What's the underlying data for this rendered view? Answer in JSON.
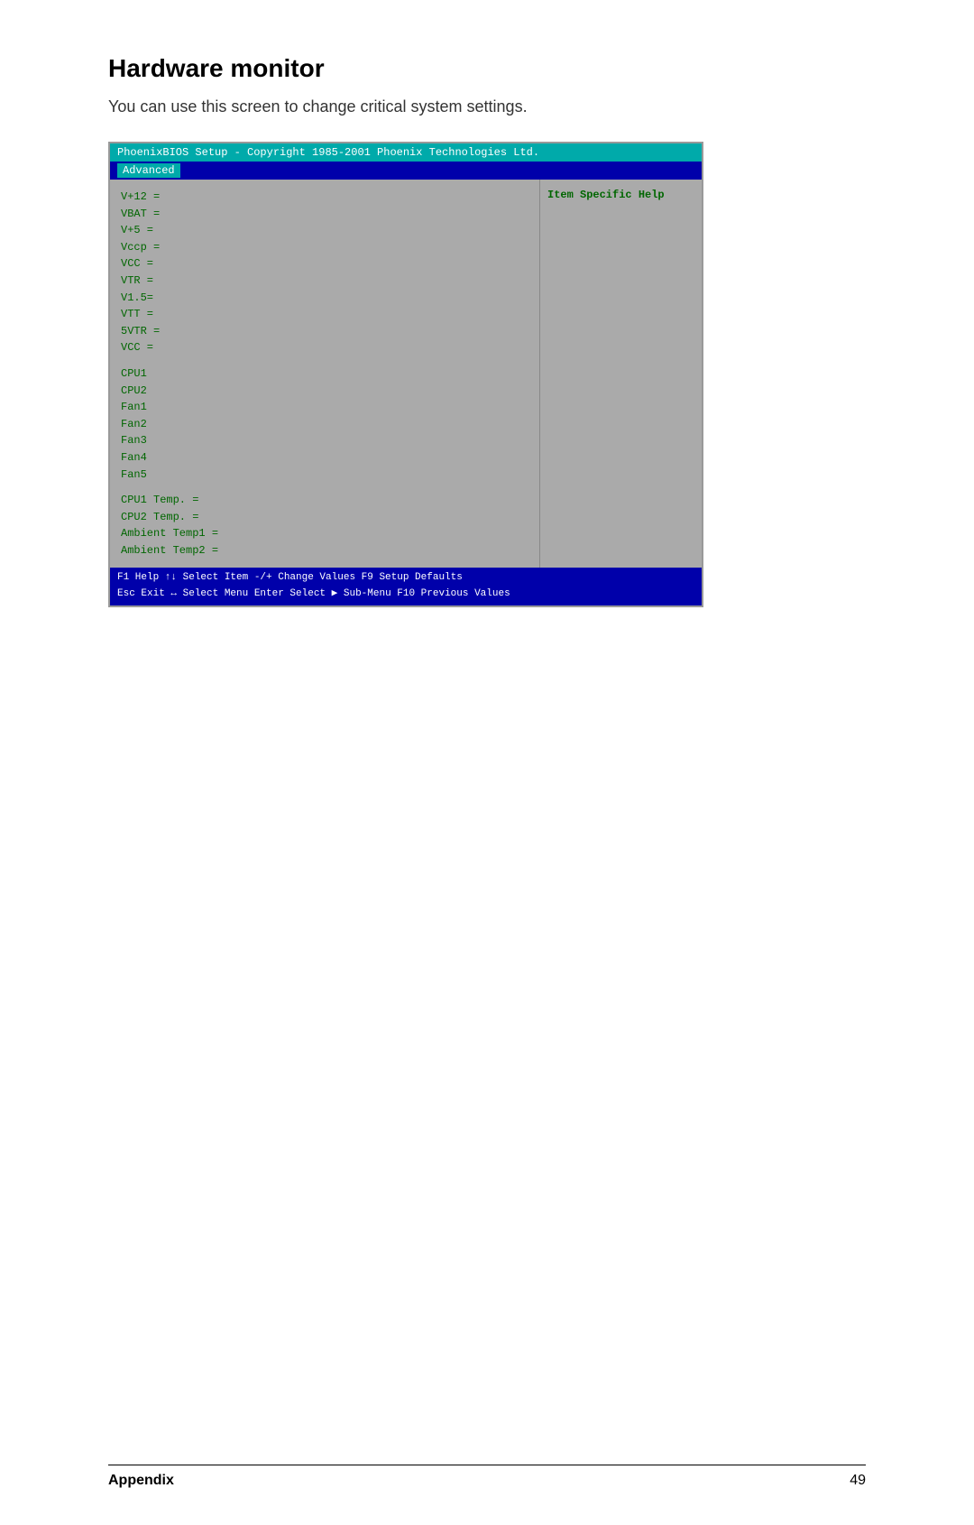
{
  "page": {
    "title": "Hardware monitor",
    "subtitle": "You can use this screen to change critical system settings.",
    "footer": {
      "left_label": "Appendix",
      "right_label": "49"
    }
  },
  "bios": {
    "title_bar": "PhoenixBIOS Setup - Copyright 1985-2001 Phoenix Technologies Ltd.",
    "menu_bar": {
      "active_item": "Advanced"
    },
    "help_panel": {
      "title": "Item Specific Help"
    },
    "voltage_items": [
      "V+12 =",
      "VBAT =",
      "V+5 =",
      "Vccp =",
      "VCC =",
      "VTR =",
      "V1.5=",
      "VTT  =",
      "5VTR =",
      "VCC ="
    ],
    "cpu_fan_items": [
      "CPU1",
      "CPU2",
      "Fan1",
      "Fan2",
      "Fan3",
      "Fan4",
      "Fan5"
    ],
    "temp_items": [
      "CPU1 Temp. =",
      "CPU2 Temp. =",
      "Ambient Temp1 =",
      "Ambient Temp2 ="
    ],
    "footer_line1": "F1 Help  ↑↓ Select Item  -/+  Change Values   F9 Setup Defaults",
    "footer_line2": "Esc Exit  ↔  Select Menu  Enter Select ▶ Sub-Menu F10 Previous Values"
  }
}
